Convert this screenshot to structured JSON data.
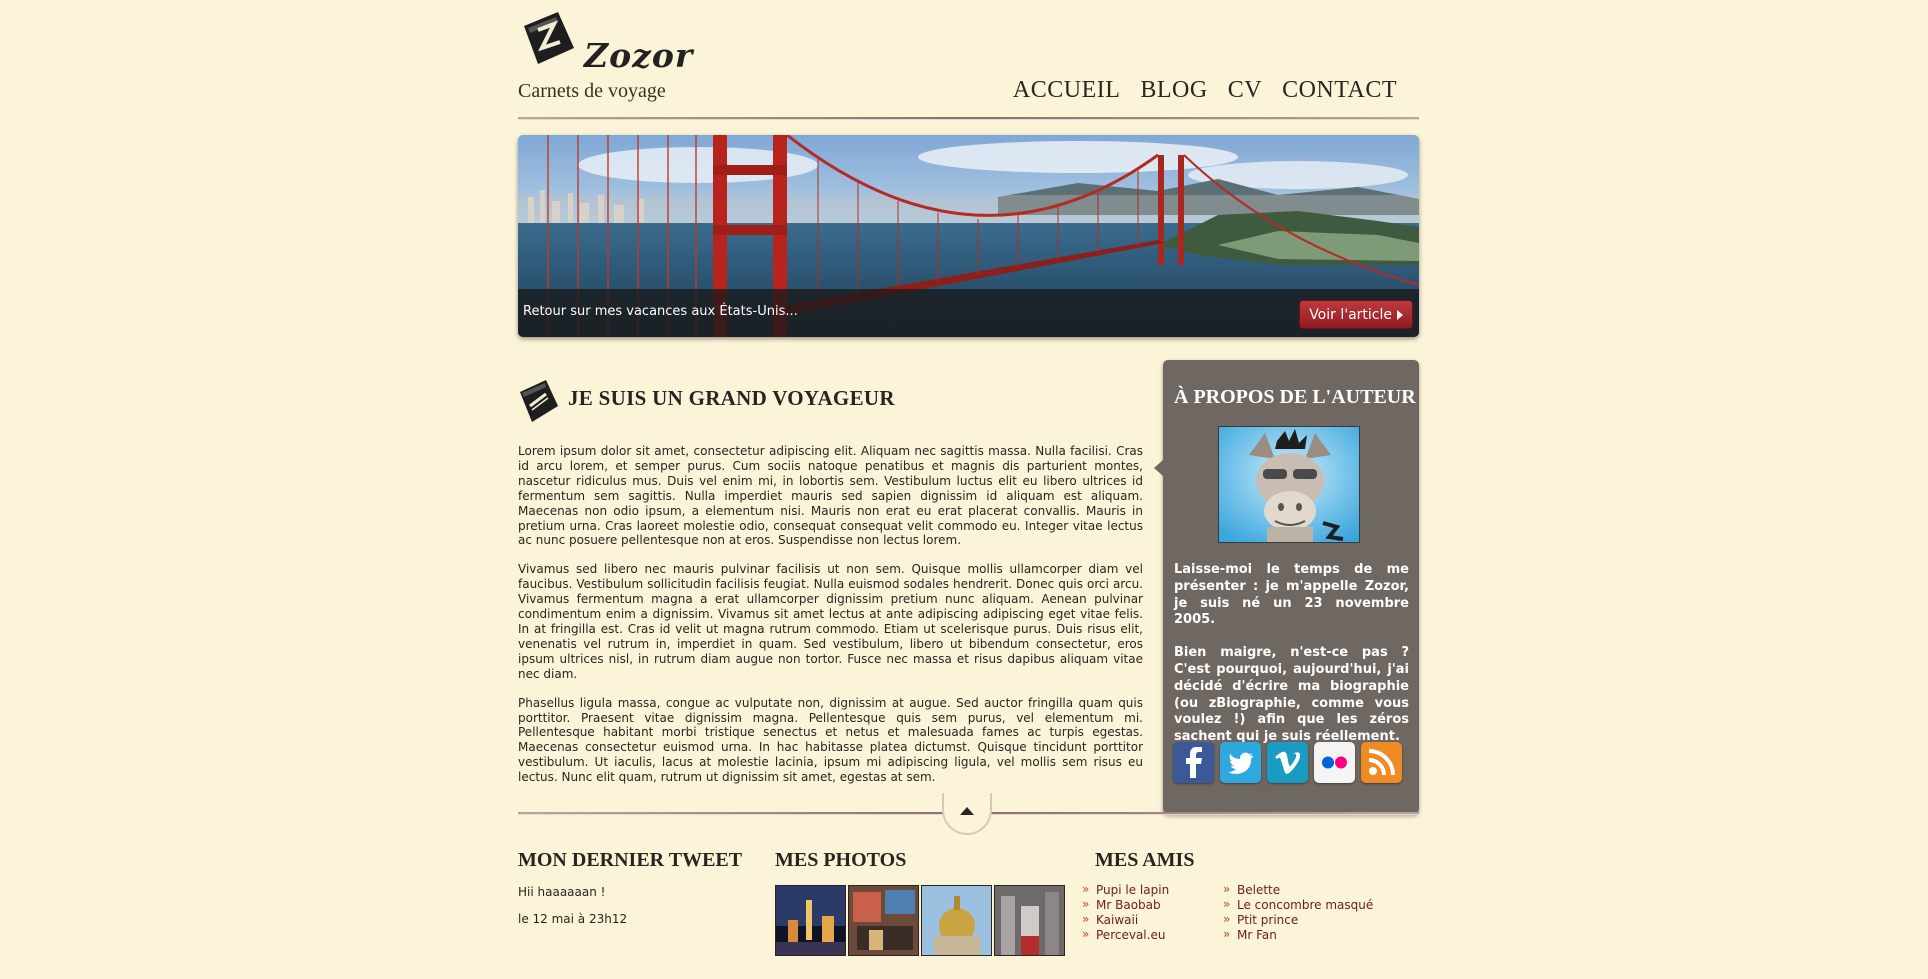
{
  "header": {
    "logo_name": "Zozor",
    "tagline": "Carnets de voyage",
    "nav": [
      "ACCUEIL",
      "BLOG",
      "CV",
      "CONTACT"
    ]
  },
  "banner": {
    "caption": "Retour sur mes vacances aux États-Unis...",
    "button_label": "Voir l'article"
  },
  "article": {
    "title": "JE SUIS UN GRAND VOYAGEUR",
    "paragraphs": [
      "Lorem ipsum dolor sit amet, consectetur adipiscing elit. Aliquam nec sagittis massa. Nulla facilisi. Cras id arcu lorem, et semper purus. Cum sociis natoque penatibus et magnis dis parturient montes, nascetur ridiculus mus. Duis vel enim mi, in lobortis sem. Vestibulum luctus elit eu libero ultrices id fermentum sem sagittis. Nulla imperdiet mauris sed sapien dignissim id aliquam est aliquam. Maecenas non odio ipsum, a elementum nisi. Mauris non erat eu erat placerat convallis. Mauris in pretium urna. Cras laoreet molestie odio, consequat consequat velit commodo eu. Integer vitae lectus ac nunc posuere pellentesque non at eros. Suspendisse non lectus lorem.",
      "Vivamus sed libero nec mauris pulvinar facilisis ut non sem. Quisque mollis ullamcorper diam vel faucibus. Vestibulum sollicitudin facilisis feugiat. Nulla euismod sodales hendrerit. Donec quis orci arcu. Vivamus fermentum magna a erat ullamcorper dignissim pretium nunc aliquam. Aenean pulvinar condimentum enim a dignissim. Vivamus sit amet lectus at ante adipiscing adipiscing eget vitae felis. In at fringilla est. Cras id velit ut magna rutrum commodo. Etiam ut scelerisque purus. Duis risus elit, venenatis vel rutrum in, imperdiet in quam. Sed vestibulum, libero ut bibendum consectetur, eros ipsum ultrices nisl, in rutrum diam augue non tortor. Fusce nec massa et risus dapibus aliquam vitae nec diam.",
      "Phasellus ligula massa, congue ac vulputate non, dignissim at augue. Sed auctor fringilla quam quis porttitor. Praesent vitae dignissim magna. Pellentesque quis sem purus, vel elementum mi. Pellentesque habitant morbi tristique senectus et netus et malesuada fames ac turpis egestas. Maecenas consectetur euismod urna. In hac habitasse platea dictumst. Quisque tincidunt porttitor vestibulum. Ut iaculis, lacus at molestie lacinia, ipsum mi adipiscing ligula, vel mollis sem risus eu lectus. Nunc elit quam, rutrum ut dignissim sit amet, egestas at sem."
    ]
  },
  "aside": {
    "title": "À PROPOS DE L'AUTEUR",
    "paragraphs": [
      "Laisse-moi le temps de me présenter : je m'appelle Zozor, je suis né un 23 novembre 2005.",
      "Bien maigre, n'est-ce pas ? C'est pourquoi, aujourd'hui, j'ai décidé d'écrire ma biographie (ou zBiographie, comme vous voulez !) afin que les zéros sachent qui je suis réellement."
    ],
    "socials": [
      {
        "icon": "facebook-icon",
        "color": "#3b5998"
      },
      {
        "icon": "twitter-icon",
        "color": "#2fa8e0"
      },
      {
        "icon": "vimeo-icon",
        "color": "#1a9bc4"
      },
      {
        "icon": "flickr-icon",
        "color": "#f4f4f4"
      },
      {
        "icon": "rss-icon",
        "color": "#f08a24"
      }
    ]
  },
  "footer": {
    "tweet_title": "MON DERNIER TWEET",
    "tweet_text": "Hii haaaaaan !",
    "tweet_date": "le 12 mai à 23h12",
    "photos_title": "MES PHOTOS",
    "friends_title": "MES AMIS",
    "friends_col1": [
      "Pupi le lapin",
      "Mr Baobab",
      "Kaiwaii",
      "Perceval.eu"
    ],
    "friends_col2": [
      "Belette",
      "Le concombre masqué",
      "Ptit prince",
      "Mr Fan"
    ]
  }
}
